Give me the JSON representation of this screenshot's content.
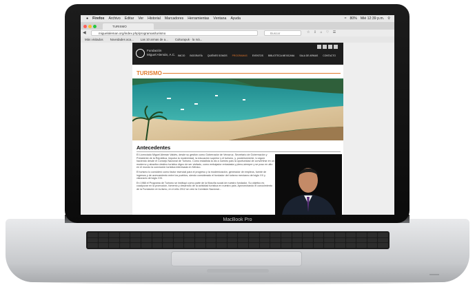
{
  "menubar": {
    "app": "Firefox",
    "items": [
      "Archivo",
      "Editar",
      "Ver",
      "Historial",
      "Marcadores",
      "Herramientas",
      "Ventana",
      "Ayuda"
    ],
    "battery": "80%",
    "clock": "Mié 12:39 p.m."
  },
  "tab": {
    "title": "TURISMO"
  },
  "urlbar": {
    "url": "miguelaleman.org/index.php/programas/turismo",
    "search_placeholder": "Buscar"
  },
  "bookmarks": [
    "Más visitados",
    "Novedades aca...",
    "Las 10 armas de a...",
    "Culturapuk · la má..."
  ],
  "site": {
    "logo_line1": "Fundación",
    "logo_line2": "Miguel Alemán, A.C.",
    "nav": [
      "INICIO",
      "BIOGRAFÍA",
      "QUIÉNES SOMOS",
      "PROGRAMAS",
      "EVENTOS",
      "BIBLIOTECA MEXICANA",
      "SALA DE ARMAS",
      "CONTACTO"
    ],
    "active_nav": "PROGRAMAS",
    "section_title": "TURISMO",
    "subtitle": "Antecedentes",
    "paragraphs": [
      "El Licenciado Miguel Alemán Valdés, desde su gestión como Gobernador de Veracruz, Secretario de Gobernación y Presidente de la República, impulsó la modernidad, la educación superior y el turismo, y, posteriormente, lo siguió haciendo desde el Consejo Nacional de Turismo. Como estadista la dio a nuestro país la oportunidad de convertirse en un moderno y atractivo destino turístico digno de ser visitado, como embajador entusiasta y pleno,siempre y se puso en alto en el mundo la convicción turística interesada en México.",
      "El turismo lo consideró como factor esencial para el progreso y la modernización, generador de empleos, fuente de ingresos y de acercamiento entre los pueblos, siendo considerado el fundador del turismo mexicano del siglo XX y visionario del siglo XXI.",
      "En 1988 el Programa de Turismo se instituyó como parte de la filosofía social de nuestro fundador. Su objetivo es coadyuvar en la promoción, fomento y desarrollo de la actividad turística en nuestro país. Aprovechando el conocimiento de la Fundación en turismo, en el año 2012 se creó la Comisión Nacional..."
    ]
  },
  "laptop": {
    "brand": "MacBook Pro"
  },
  "colors": {
    "accent": "#e07a2c",
    "header": "#1e1e1e"
  }
}
